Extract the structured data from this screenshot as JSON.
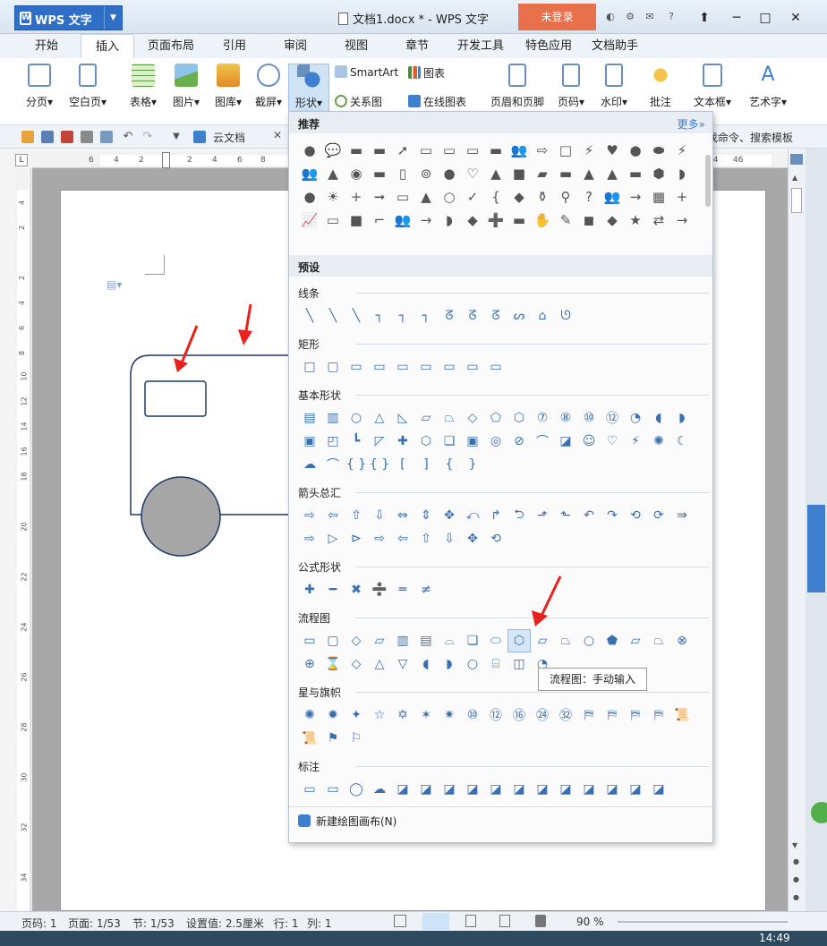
{
  "app": {
    "name": "WPS 文字",
    "doc_title": "文档1.docx * - WPS 文字",
    "login_label": "未登录"
  },
  "tabs": [
    "开始",
    "插入",
    "页面布局",
    "引用",
    "审阅",
    "视图",
    "章节",
    "开发工具",
    "特色应用",
    "文档助手"
  ],
  "active_tab": "插入",
  "ribbon": {
    "big": [
      "分页",
      "空白页",
      "表格",
      "图片",
      "图库",
      "截屏",
      "形状",
      "页眉和页脚",
      "页码",
      "水印",
      "批注",
      "文本框",
      "艺术字"
    ],
    "small": {
      "smartart": "SmartArt",
      "chart": "图表",
      "relation": "关系图",
      "online_chart": "在线图表"
    }
  },
  "qat": {
    "cloud_doc": "云文档",
    "search_hint": "找命令、搜索模板"
  },
  "ruler_h": [
    "6",
    "4",
    "2",
    "2",
    "4",
    "6",
    "8",
    "40",
    "42",
    "44",
    "46"
  ],
  "ruler_v": [
    "4",
    "2",
    "2",
    "4",
    "6",
    "8",
    "10",
    "12",
    "14",
    "16",
    "18",
    "20",
    "22",
    "24",
    "26",
    "28",
    "30",
    "32",
    "34"
  ],
  "panel": {
    "recommended_title": "推荐",
    "more_label": "更多»",
    "presets_title": "预设",
    "sections": [
      "线条",
      "矩形",
      "基本形状",
      "箭头总汇",
      "公式形状",
      "流程图",
      "星与旗帜",
      "标注"
    ],
    "new_canvas": "新建绘图画布(N)",
    "tooltip": "流程图：手动输入",
    "recommended_rows": [
      [
        "●",
        "💬",
        "▬",
        "▬",
        "➚",
        "▭",
        "▭",
        "▭",
        "▬",
        "👥",
        "⇨",
        "□",
        "⚡",
        "♥",
        "●",
        "⬬",
        "⚡"
      ],
      [
        "👥",
        "▲",
        "◉",
        "▬",
        "▯",
        "⊚",
        "●",
        "♡",
        "▲",
        "■",
        "▰",
        "▬",
        "▲",
        "▲",
        "▬",
        "⬢",
        "◗"
      ],
      [
        "●",
        "☀",
        "+",
        "➞",
        "▭",
        "▲",
        "○",
        "✓",
        "{",
        "◆",
        "⚱",
        "⚲",
        "?",
        "👥",
        "→",
        "▦",
        "+"
      ],
      [
        "📈",
        "▭",
        "■",
        "⌐",
        "👥",
        "→",
        "◗",
        "◆",
        "➕",
        "▬",
        "✋",
        "✎",
        "◼",
        "◆",
        "★",
        "⇄",
        "→"
      ]
    ],
    "lines": [
      "╲",
      "╲",
      "╲",
      "┐",
      "┐",
      "┐",
      "ᘔ",
      "ᘔ",
      "ᘔ",
      "ᔕ",
      "⌂",
      "ᘎ"
    ],
    "rects": [
      "□",
      "▢",
      "▭",
      "▭",
      "▭",
      "▭",
      "▭",
      "▭",
      "▭"
    ],
    "basic": [
      "▤",
      "▥",
      "○",
      "△",
      "◺",
      "▱",
      "⏢",
      "◇",
      "⬠",
      "⬡",
      "⑦",
      "⑧",
      "⑩",
      "⑫",
      "◔",
      "◖",
      "◗",
      "▣",
      "◰",
      "┗",
      "◸",
      "✚",
      "⬡",
      "❏",
      "▣",
      "◎",
      "⊘",
      "⌒",
      "◪",
      "☺",
      "♡",
      "⚡",
      "✺",
      "☾",
      "☁",
      "⌒",
      "{ }",
      "{ }",
      "[",
      "]",
      "{",
      "}"
    ],
    "arrows": [
      "⇨",
      "⇦",
      "⇧",
      "⇩",
      "⇔",
      "⇕",
      "✥",
      "⤺",
      "↱",
      "⮌",
      "⬏",
      "⬑",
      "↶",
      "↷",
      "⟲",
      "⟳",
      "⇛",
      "⇨",
      "▷",
      "⊳",
      "⇨",
      "⇦",
      "⇧",
      "⇩",
      "✥",
      "⟲"
    ],
    "formula": [
      "✚",
      "━",
      "✖",
      "➗",
      "═",
      "≠"
    ],
    "flow": [
      "▭",
      "▢",
      "◇",
      "▱",
      "▥",
      "▤",
      "⌓",
      "❏",
      "⬭",
      "⬡",
      "⏥",
      "⏢",
      "○",
      "⬟",
      "▱",
      "⏢",
      "⊗",
      "⊕",
      "⌛",
      "◇",
      "△",
      "▽",
      "◖",
      "◗",
      "○",
      "⌸",
      "◫",
      "◔"
    ],
    "stars": [
      "✺",
      "✹",
      "✦",
      "☆",
      "✡",
      "✶",
      "✷",
      "⑩",
      "⑫",
      "⑯",
      "㉔",
      "㉜",
      "⛿",
      "⛿",
      "⛿",
      "⛿",
      "📜"
    ],
    "stars_row2": [
      "📜",
      "⚑",
      "⚐"
    ],
    "callouts": [
      "▭",
      "▭",
      "◯",
      "☁",
      "◪",
      "◪",
      "◪",
      "◪",
      "◪",
      "◪",
      "◪",
      "◪",
      "◪",
      "◪",
      "◪",
      "◪"
    ]
  },
  "status": {
    "pageno": "页码: 1",
    "pages": "页面: 1/53",
    "section": "节: 1/53",
    "setting": "设置值: 2.5厘米",
    "row": "行: 1",
    "col": "列: 1",
    "zoom": "90 %"
  },
  "clock": "14:49",
  "colors": {
    "accent": "#2f6fc8",
    "login": "#e8704a",
    "arrow": "#e82020",
    "shape_fill": "#a6a6a6",
    "shape_stroke": "#1f3864"
  }
}
